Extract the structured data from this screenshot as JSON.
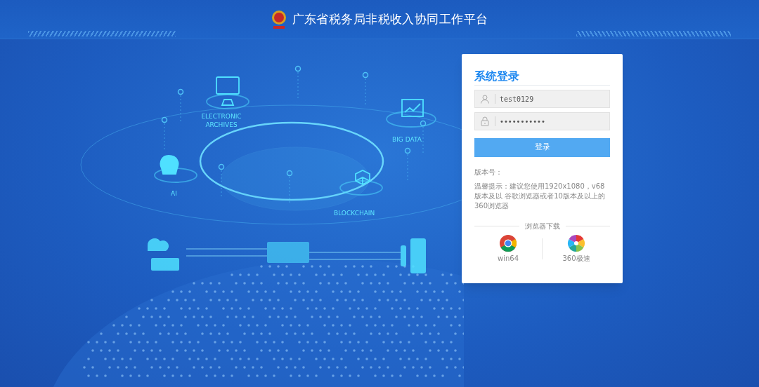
{
  "header": {
    "title": "广东省税务局非税收入协同工作平台"
  },
  "illustration": {
    "labels": [
      "ELECTRONIC ARCHIVES",
      "BIG DATA",
      "AI",
      "BLOCKCHAIN"
    ]
  },
  "login": {
    "title": "系统登录",
    "username": {
      "value": "test0129"
    },
    "password": {
      "value": "•••••••••••"
    },
    "submit": "登录",
    "version_label": "版本号：",
    "tip": "温馨提示：建议您使用1920x1080，v68版本及以 谷歌浏览器或者10版本及以上的360浏览器",
    "downloads": {
      "title": "浏览器下载",
      "items": [
        {
          "kind": "chrome",
          "label": "win64"
        },
        {
          "kind": "speed",
          "label": "360极速"
        }
      ]
    }
  }
}
